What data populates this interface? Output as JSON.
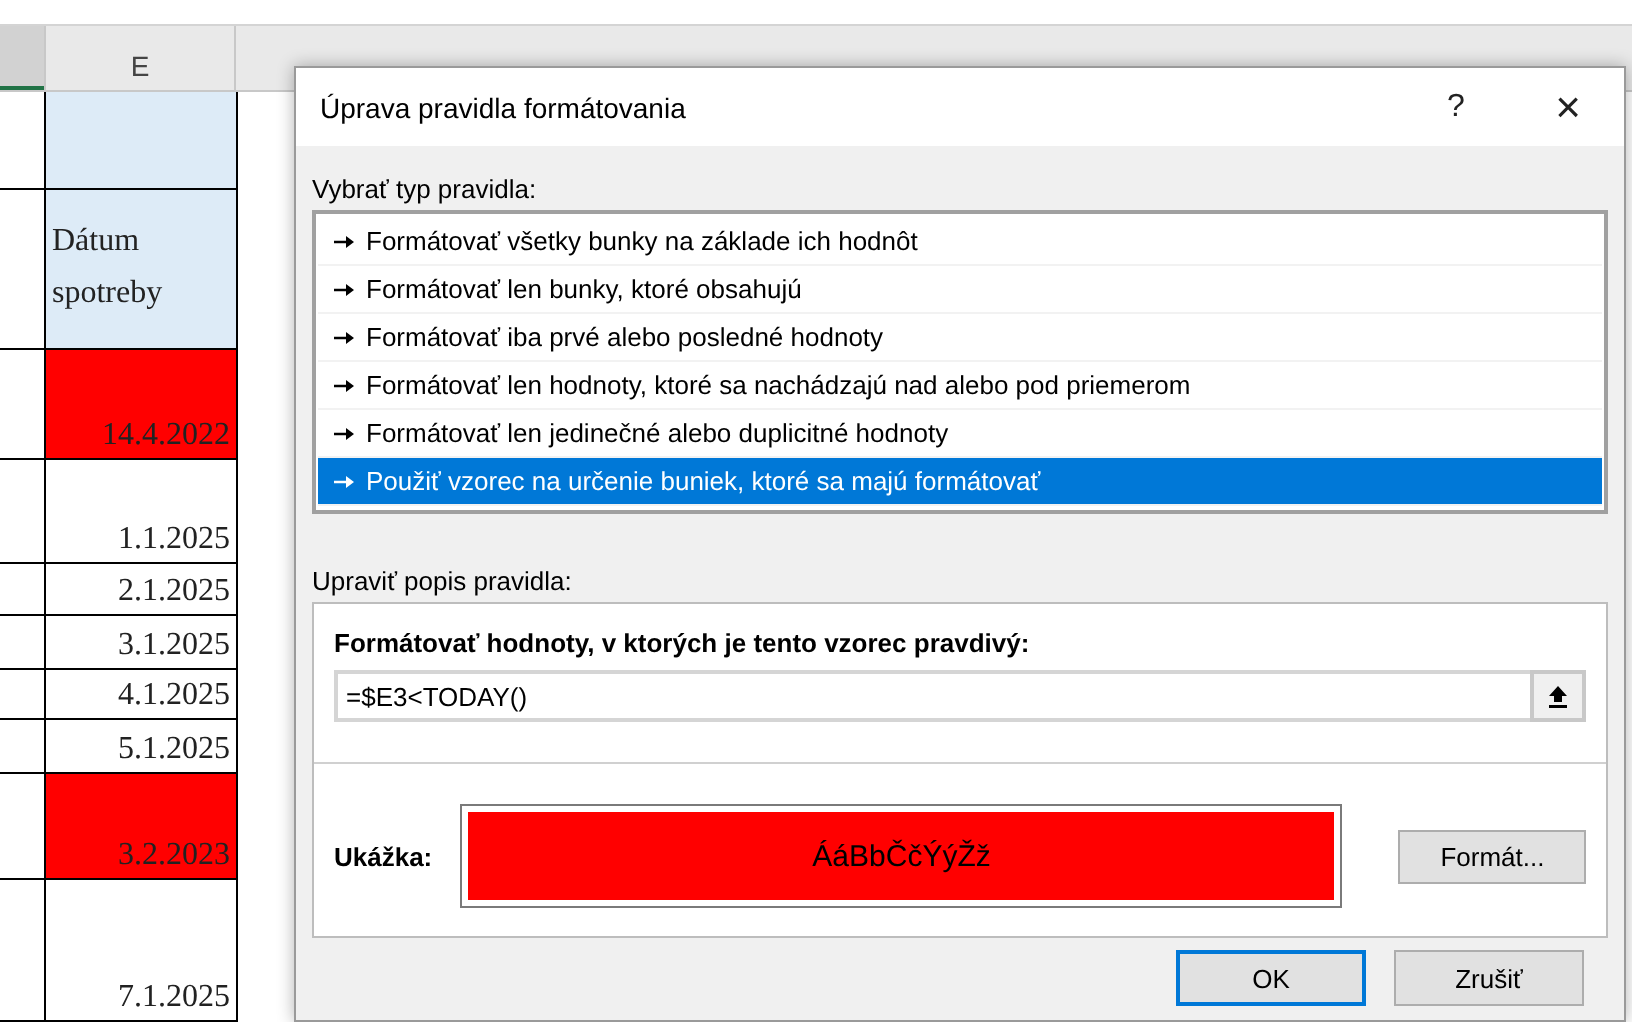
{
  "sheet": {
    "column_header": "E",
    "cells": [
      {
        "kind": "band",
        "text": "",
        "highlighted": false
      },
      {
        "kind": "header",
        "text": "Dátum spotreby",
        "highlighted": false
      },
      {
        "kind": "date",
        "text": "14.4.2022",
        "highlighted": true
      },
      {
        "kind": "date",
        "text": "1.1.2025",
        "highlighted": false
      },
      {
        "kind": "date",
        "text": "2.1.2025",
        "highlighted": false
      },
      {
        "kind": "date",
        "text": "3.1.2025",
        "highlighted": false
      },
      {
        "kind": "date",
        "text": "4.1.2025",
        "highlighted": false
      },
      {
        "kind": "date",
        "text": "5.1.2025",
        "highlighted": false
      },
      {
        "kind": "date",
        "text": "3.2.2023",
        "highlighted": true
      },
      {
        "kind": "date",
        "text": "7.1.2025",
        "highlighted": false
      }
    ]
  },
  "dialog": {
    "title": "Úprava pravidla formátovania",
    "help": "?",
    "close": "×",
    "rule_type_label": "Vybrať typ pravidla:",
    "rule_types": [
      {
        "label": "Formátovať všetky bunky na základe ich hodnôt",
        "selected": false
      },
      {
        "label": "Formátovať len bunky, ktoré obsahujú",
        "selected": false
      },
      {
        "label": "Formátovať iba prvé alebo posledné hodnoty",
        "selected": false
      },
      {
        "label": "Formátovať len hodnoty, ktoré sa nachádzajú nad alebo pod priemerom",
        "selected": false
      },
      {
        "label": "Formátovať len jedinečné alebo duplicitné hodnoty",
        "selected": false
      },
      {
        "label": "Použiť vzorec na určenie buniek, ktoré sa majú formátovať",
        "selected": true
      }
    ],
    "description_label": "Upraviť popis pravidla:",
    "formula_label": "Formátovať hodnoty, v ktorých je tento vzorec pravdivý:",
    "formula": "=$E3<TODAY()",
    "preview_label": "Ukážka:",
    "preview_text": "ÁáBbČčÝýŽž",
    "format_button": "Formát...",
    "ok_button": "OK",
    "cancel_button": "Zrušiť"
  }
}
